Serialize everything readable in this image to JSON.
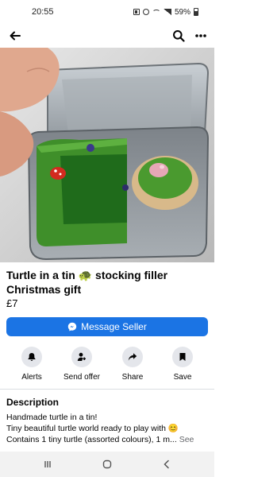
{
  "status_bar": {
    "time": "20:55",
    "battery": "59%",
    "icons": [
      "nfc-icon",
      "alarm-icon",
      "wifi-icon",
      "signal-icon",
      "battery-icon"
    ]
  },
  "nav": {
    "icons": [
      "back-arrow-icon",
      "search-icon",
      "more-icon"
    ]
  },
  "listing": {
    "title": "Turtle in a tin 🐢 stocking filler Christmas gift",
    "price": "£7",
    "photo_index": 1,
    "photo_count": 3
  },
  "message_button": {
    "label": "Message Seller",
    "icon": "messenger-icon"
  },
  "actions": [
    {
      "label": "Alerts",
      "icon": "bell-icon"
    },
    {
      "label": "Send offer",
      "icon": "send-offer-icon"
    },
    {
      "label": "Share",
      "icon": "share-icon"
    },
    {
      "label": "Save",
      "icon": "bookmark-icon"
    }
  ],
  "description": {
    "heading": "Description",
    "lines": [
      "Handmade turtle in a tin!",
      "Tiny beautiful turtle world ready to play with 😊",
      "Contains 1 tiny turtle (assorted colours), 1 m..."
    ],
    "see_more": "See"
  },
  "android_nav": {
    "icons": [
      "recents-icon",
      "home-icon",
      "android-back-icon"
    ]
  },
  "colors": {
    "accent": "#1b74e4",
    "action_bg": "#e4e6eb",
    "text": "#050505",
    "muted": "#65676b"
  }
}
